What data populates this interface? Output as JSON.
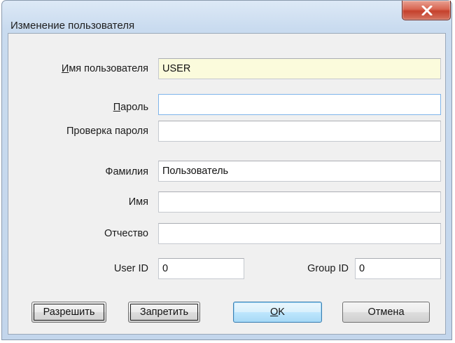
{
  "window": {
    "title": "Изменение пользователя"
  },
  "form": {
    "username": {
      "label_accel": "И",
      "label_rest": "мя пользователя",
      "value": "USER"
    },
    "password": {
      "label_accel": "П",
      "label_rest": "ароль",
      "value": ""
    },
    "password_confirm": {
      "label": "Проверка пароля",
      "value": ""
    },
    "last_name": {
      "label": "Фамилия",
      "value": "Пользователь"
    },
    "first_name": {
      "label": "Имя",
      "value": ""
    },
    "middle_name": {
      "label": "Отчество",
      "value": ""
    },
    "user_id": {
      "label": "User ID",
      "value": "0"
    },
    "group_id": {
      "label": "Group ID",
      "value": "0"
    }
  },
  "buttons": {
    "allow": "Разрешить",
    "deny": "Запретить",
    "ok_accel": "O",
    "ok_rest": "K",
    "cancel": "Отмена"
  }
}
